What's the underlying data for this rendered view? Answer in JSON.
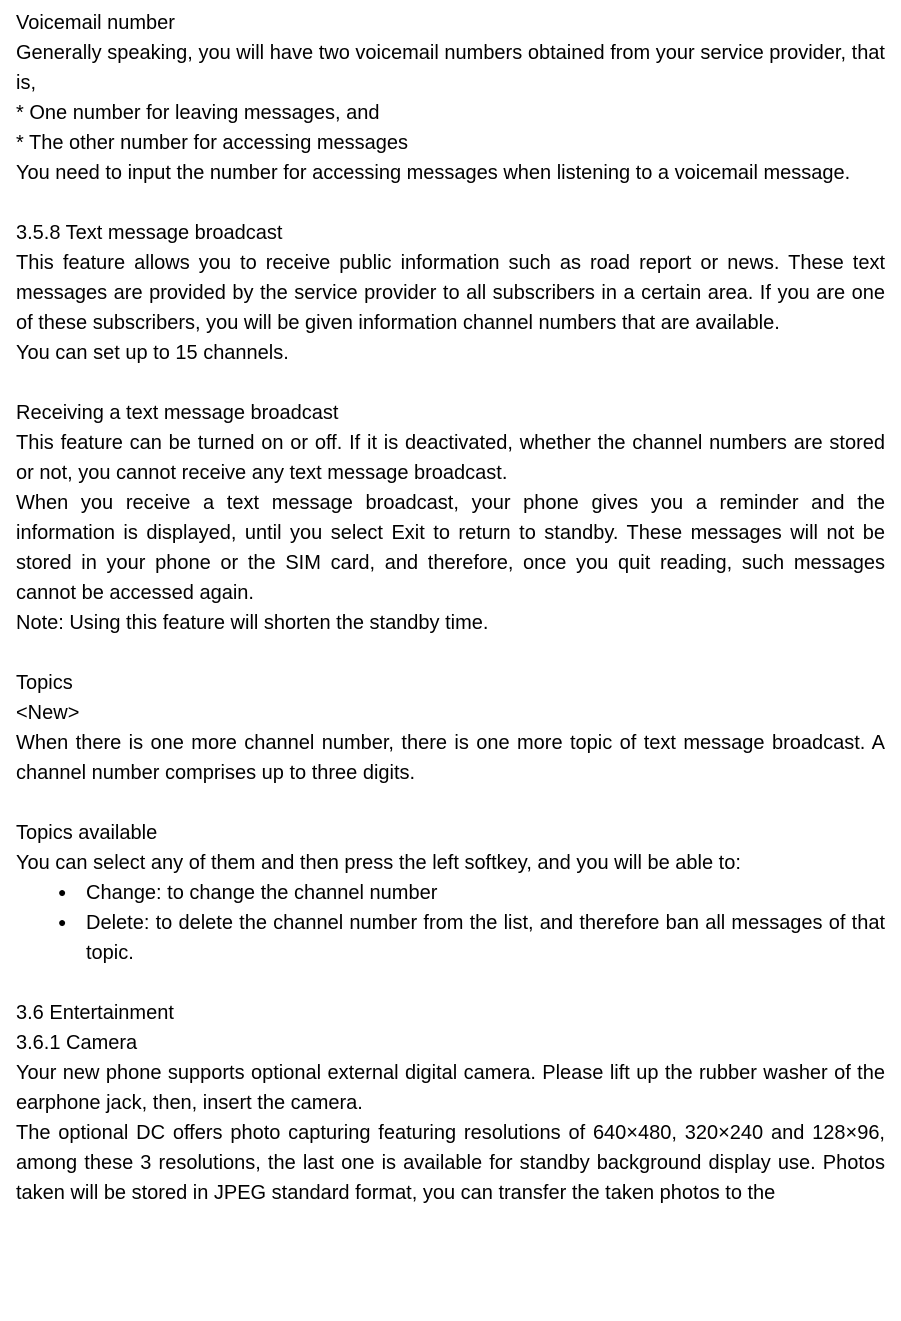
{
  "voicemail": {
    "heading": "Voicemail number",
    "p1": "Generally speaking, you will have two voicemail numbers obtained from your service provider, that is,",
    "b1": "* One number for leaving messages, and",
    "b2": "* The other number for accessing messages",
    "p2": "You need to input the number for accessing messages when listening to a voicemail message."
  },
  "broadcast": {
    "heading": "3.5.8 Text message broadcast",
    "p1": "This feature allows you to receive public information such as road report or news. These text messages are provided by the service provider to all subscribers in a certain area. If you are one of these subscribers, you will be given information channel numbers that are available.",
    "p2": "You can set up to 15 channels."
  },
  "receiving": {
    "heading": "Receiving a text message broadcast",
    "p1": "This feature can be turned on or off. If it is deactivated, whether the channel numbers are stored or not, you cannot receive any text message broadcast.",
    "p2": "When you receive a text message broadcast, your phone gives you a reminder and the information is displayed, until you select Exit to return to standby. These messages will not be stored in your phone or the SIM card, and therefore, once you quit reading, such messages cannot be accessed again.",
    "note": "Note: Using this feature will shorten the standby time."
  },
  "topics": {
    "heading": "Topics",
    "new": "<New>",
    "p1": "When there is one more channel number, there is one more topic of text message broadcast. A channel number comprises up to three digits."
  },
  "topicsAvailable": {
    "heading": "Topics available",
    "p1": "You can select any of them and then press the left softkey, and you will be able to:",
    "items": [
      "Change: to change the channel number",
      "Delete: to delete the channel number from the list, and therefore ban all messages of that topic."
    ]
  },
  "entertainment": {
    "heading": "3.6 Entertainment",
    "camera": "3.6.1 Camera",
    "p1": "Your new phone supports optional external digital camera. Please lift up the rubber washer of the earphone jack, then, insert the camera.",
    "p2": "The optional DC offers photo capturing featuring resolutions of 640×480, 320×240 and 128×96, among these 3 resolutions, the last one is available for standby background display use. Photos taken will be stored in JPEG standard format, you can transfer the taken photos to the"
  }
}
